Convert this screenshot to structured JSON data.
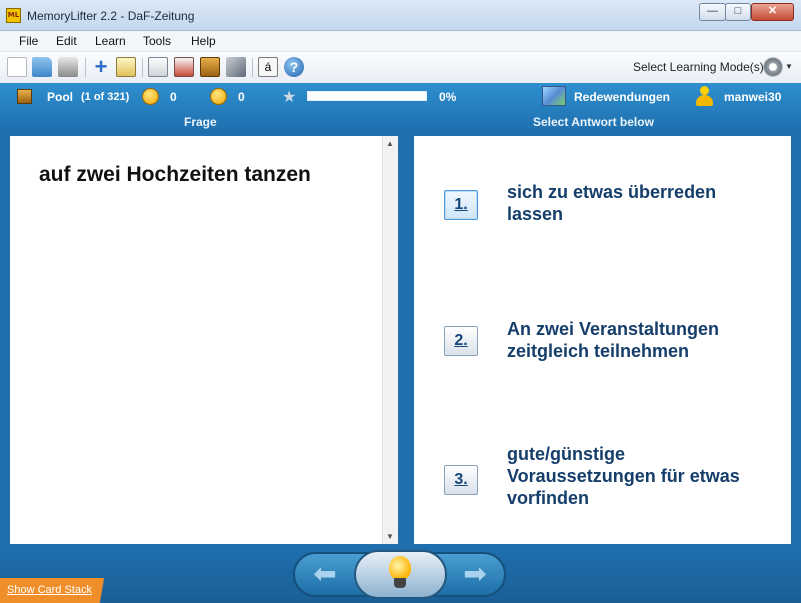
{
  "window": {
    "app_icon_text": "ML",
    "title": "MemoryLifter 2.2 - DaF-Zeitung",
    "min_glyph": "—",
    "max_glyph": "□",
    "close_glyph": "✕"
  },
  "menu": [
    "File",
    "Edit",
    "Learn",
    "Tools",
    "Help"
  ],
  "toolbar": {
    "icons": [
      "new-file-icon",
      "open-folder-icon",
      "print-icon",
      "add-icon",
      "edit-icon",
      "presentation-icon",
      "print-preview-icon",
      "book-icon",
      "tools-icon",
      "special-char-icon",
      "help-icon"
    ],
    "special_char_glyph": "á",
    "help_glyph": "?",
    "select_mode_label": "Select Learning Mode(s)"
  },
  "status": {
    "pool_label": "Pool",
    "pool_count": "(1 of 321)",
    "correct_count": "0",
    "wrong_count": "0",
    "progress_percent_value": 0,
    "progress_label": "0%",
    "chapter": "Redewendungen",
    "user": "manwei30"
  },
  "headers": {
    "question": "Frage",
    "answer": "Select Antwort below"
  },
  "question": {
    "text": "auf zwei Hochzeiten tanzen"
  },
  "answers": [
    {
      "number": "1.",
      "text": "sich zu etwas überreden lassen"
    },
    {
      "number": "2.",
      "text": "An zwei Veranstaltungen zeitgleich teilnehmen"
    },
    {
      "number": "3.",
      "text": "gute/günstige Voraussetzungen für etwas vorfinden"
    }
  ],
  "footer": {
    "show_card_stack": "Show Card Stack",
    "prev_glyph": "⬅",
    "next_glyph": "➡"
  }
}
